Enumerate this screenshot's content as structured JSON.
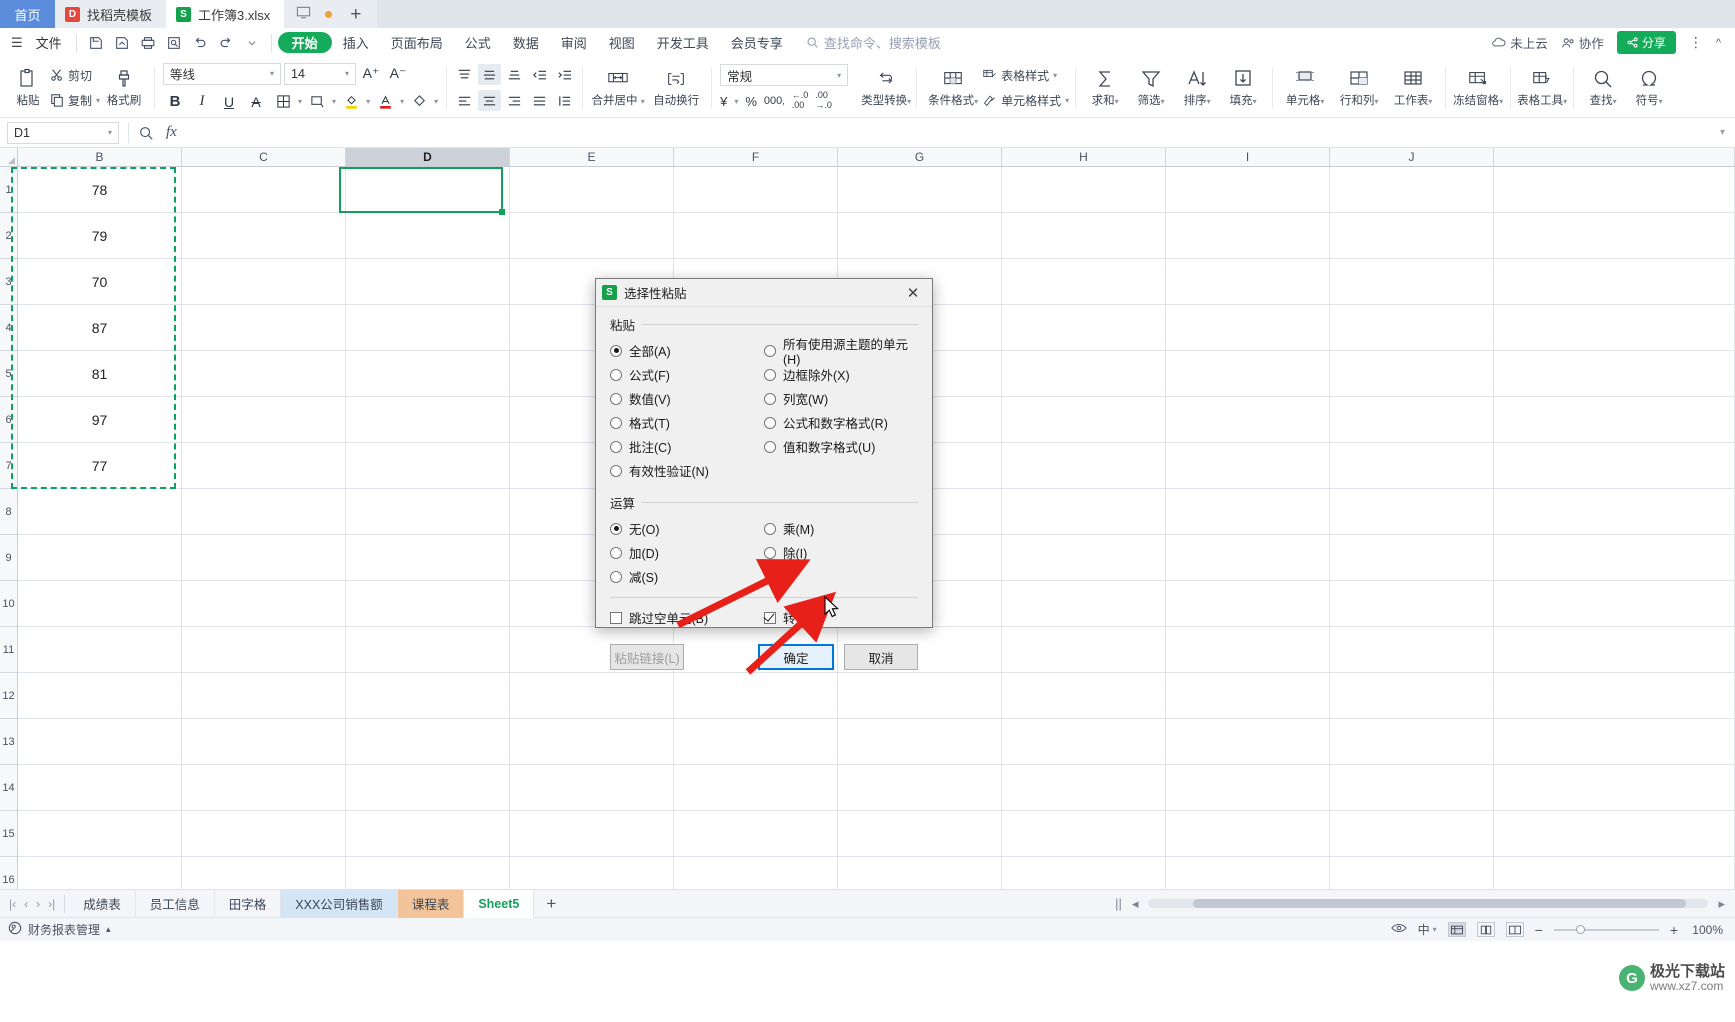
{
  "tabbar": {
    "home_label": "首页",
    "tabs": [
      {
        "label": "找稻壳模板",
        "icon": "daoke-icon",
        "active": false
      },
      {
        "label": "工作簿3.xlsx",
        "icon": "spreadsheet-icon",
        "active": true
      }
    ],
    "new_tab": "+"
  },
  "menu": {
    "file_label": "文件",
    "items": [
      "开始",
      "插入",
      "页面布局",
      "公式",
      "数据",
      "审阅",
      "视图",
      "开发工具",
      "会员专享"
    ],
    "active_item": "开始",
    "search_placeholder": "查找命令、搜索模板",
    "cloud_label": "未上云",
    "collab_label": "协作",
    "share_label": "分享"
  },
  "ribbon": {
    "paste_label": "粘贴",
    "cut_label": "剪切",
    "copy_label": "复制",
    "format_painter_label": "格式刷",
    "font_name": "等线",
    "font_size": "14",
    "merge_label": "合并居中",
    "wrap_label": "自动换行",
    "number_format": "常规",
    "type_convert_label": "类型转换",
    "cond_format_label": "条件格式",
    "cell_style_label": "单元格样式",
    "table_style_label": "表格样式",
    "sum_label": "求和",
    "filter_label": "筛选",
    "sort_label": "排序",
    "fill_label": "填充",
    "cell_label": "单元格",
    "rowcol_label": "行和列",
    "sheet_label": "工作表",
    "freeze_label": "冻结窗格",
    "table_tools_label": "表格工具",
    "find_label": "查找",
    "symbol_label": "符号"
  },
  "formula_bar": {
    "name_box": "D1",
    "fx_label": "fx",
    "formula_value": ""
  },
  "grid": {
    "columns": [
      "B",
      "C",
      "D",
      "E",
      "F",
      "G",
      "H",
      "I",
      "J"
    ],
    "selected_column": "D",
    "rows": [
      "",
      "",
      "",
      "",
      "",
      "",
      "",
      "",
      "",
      "",
      "",
      "",
      "",
      "",
      "",
      ""
    ],
    "copied_values": [
      "78",
      "79",
      "70",
      "87",
      "81",
      "97",
      "77"
    ],
    "copied_column": "B",
    "active_cell": "D1"
  },
  "dialog": {
    "title": "选择性粘贴",
    "icon": "spreadsheet-icon",
    "close_icon": "close-icon",
    "paste_group_label": "粘贴",
    "paste_options_left": [
      {
        "label": "全部(A)",
        "checked": true
      },
      {
        "label": "公式(F)",
        "checked": false
      },
      {
        "label": "数值(V)",
        "checked": false
      },
      {
        "label": "格式(T)",
        "checked": false
      },
      {
        "label": "批注(C)",
        "checked": false
      },
      {
        "label": "有效性验证(N)",
        "checked": false
      }
    ],
    "paste_options_right": [
      {
        "label": "所有使用源主题的单元(H)",
        "checked": false
      },
      {
        "label": "边框除外(X)",
        "checked": false
      },
      {
        "label": "列宽(W)",
        "checked": false
      },
      {
        "label": "公式和数字格式(R)",
        "checked": false
      },
      {
        "label": "值和数字格式(U)",
        "checked": false
      }
    ],
    "operation_group_label": "运算",
    "operation_options_left": [
      {
        "label": "无(O)",
        "checked": true
      },
      {
        "label": "加(D)",
        "checked": false
      },
      {
        "label": "减(S)",
        "checked": false
      }
    ],
    "operation_options_right": [
      {
        "label": "乘(M)",
        "checked": false
      },
      {
        "label": "除(I)",
        "checked": false
      }
    ],
    "skip_blanks": {
      "label": "跳过空单元(B)",
      "checked": false
    },
    "transpose": {
      "label": "转置(E)",
      "checked": true
    },
    "paste_link_label": "粘贴链接(L)",
    "ok_label": "确定",
    "cancel_label": "取消"
  },
  "sheet_tabs": {
    "tabs": [
      {
        "label": "成绩表",
        "style": "plain"
      },
      {
        "label": "员工信息",
        "style": "plain"
      },
      {
        "label": "田字格",
        "style": "plain"
      },
      {
        "label": "XXX公司销售额",
        "style": "blue"
      },
      {
        "label": "课程表",
        "style": "orange"
      },
      {
        "label": "Sheet5",
        "style": "active"
      }
    ],
    "add_label": "+"
  },
  "status_bar": {
    "left_label": "财务报表管理",
    "zoom_label": "100%",
    "zoom_minus": "−",
    "zoom_plus": "+"
  },
  "watermark": {
    "logo_letter": "G",
    "line1": "极光下载站",
    "line2": "www.xz7.com"
  },
  "colors": {
    "accent_green": "#14ab5a",
    "selection_green": "#14a05a",
    "tab_blue": "#5b8cdc",
    "dialog_bg": "#f0f0f0",
    "primary_btn_border": "#0078d7",
    "arrow_red": "#e8201a"
  }
}
